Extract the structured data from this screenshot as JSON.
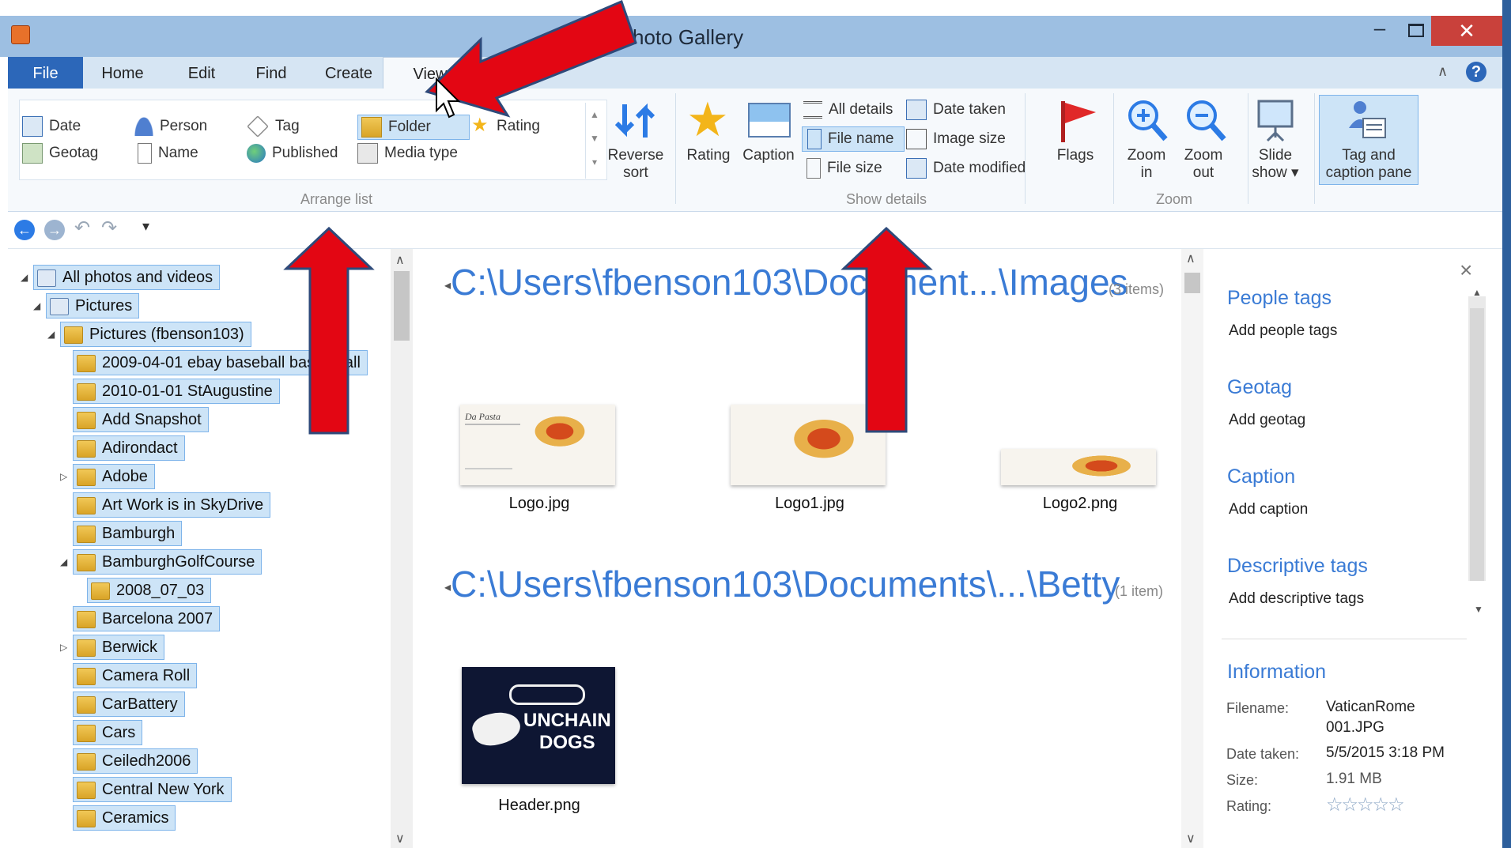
{
  "window": {
    "title": "hoto Gallery",
    "minimize": "–",
    "close": "✕"
  },
  "tabs": [
    "File",
    "Home",
    "Edit",
    "Find",
    "Create",
    "View"
  ],
  "ribbon": {
    "arrange": {
      "items": [
        "Date",
        "Person",
        "Tag",
        "Folder",
        "Rating",
        "Geotag",
        "Name",
        "Published",
        "Media type"
      ],
      "reverse_sort": [
        "Reverse",
        "sort"
      ],
      "label": "Arrange list"
    },
    "show_details": {
      "rating": "Rating",
      "caption": "Caption",
      "items": [
        "All details",
        "Date taken",
        "File name",
        "Image size",
        "File size",
        "Date modified"
      ],
      "label": "Show details"
    },
    "flags": "Flags",
    "zoom": {
      "zoom_in": [
        "Zoom",
        "in"
      ],
      "zoom_out": [
        "Zoom",
        "out"
      ],
      "label": "Zoom"
    },
    "slide_show": [
      "Slide",
      "show ▾"
    ],
    "tag_pane": [
      "Tag and",
      "caption pane"
    ]
  },
  "tree": [
    {
      "label": "All photos and videos",
      "level": 0,
      "expander": "◢"
    },
    {
      "label": "Pictures",
      "level": 1,
      "expander": "◢"
    },
    {
      "label": "Pictures (fbenson103)",
      "level": 2,
      "expander": "◢"
    },
    {
      "label": "2009-04-01 ebay baseball basketball",
      "level": 3,
      "expander": ""
    },
    {
      "label": "2010-01-01 StAugustine",
      "level": 3,
      "expander": ""
    },
    {
      "label": "Add Snapshot",
      "level": 3,
      "expander": ""
    },
    {
      "label": "Adirondact",
      "level": 3,
      "expander": ""
    },
    {
      "label": "Adobe",
      "level": 3,
      "expander": "▷"
    },
    {
      "label": "Art Work is in SkyDrive",
      "level": 3,
      "expander": ""
    },
    {
      "label": "Bamburgh",
      "level": 3,
      "expander": ""
    },
    {
      "label": "BamburghGolfCourse",
      "level": 3,
      "expander": "◢"
    },
    {
      "label": "2008_07_03",
      "level": 4,
      "expander": ""
    },
    {
      "label": "Barcelona 2007",
      "level": 3,
      "expander": ""
    },
    {
      "label": "Berwick",
      "level": 3,
      "expander": "▷"
    },
    {
      "label": "Camera Roll",
      "level": 3,
      "expander": ""
    },
    {
      "label": "CarBattery",
      "level": 3,
      "expander": ""
    },
    {
      "label": "Cars",
      "level": 3,
      "expander": ""
    },
    {
      "label": "Ceiledh2006",
      "level": 3,
      "expander": ""
    },
    {
      "label": "Central New York",
      "level": 3,
      "expander": ""
    },
    {
      "label": "Ceramics",
      "level": 3,
      "expander": ""
    }
  ],
  "groups": [
    {
      "path": "C:\\Users\\fbenson103\\Document...\\Images",
      "count": "(3 items)",
      "files": [
        "Logo.jpg",
        "Logo1.jpg",
        "Logo2.png"
      ]
    },
    {
      "path": "C:\\Users\\fbenson103\\Documents\\...\\Betty",
      "count": "(1 item)",
      "files": [
        "Header.png"
      ]
    }
  ],
  "header_image_text": [
    "UNCHAIN",
    "DOGS"
  ],
  "logo_text": "Da Pasta",
  "info_pane": {
    "close": "×",
    "people_tags": "People tags",
    "add_people": "Add people tags",
    "geotag": "Geotag",
    "add_geotag": "Add geotag",
    "caption": "Caption",
    "add_caption": "Add caption",
    "descriptive": "Descriptive tags",
    "add_descriptive": "Add descriptive tags",
    "information": "Information",
    "filename_label": "Filename:",
    "filename_1": "VaticanRome",
    "filename_2": "001.JPG",
    "date_label": "Date taken:",
    "date_value": "5/5/2015  3:18 PM",
    "size_label": "Size:",
    "size_value": "1.91 MB",
    "rating_label": "Rating:",
    "rating_value": "☆☆☆☆☆"
  },
  "colors": {
    "accent": "#2c67b9",
    "heading_blue": "#3a7bd5",
    "selection": "#cde4f7",
    "arrow_red": "#e30613"
  }
}
